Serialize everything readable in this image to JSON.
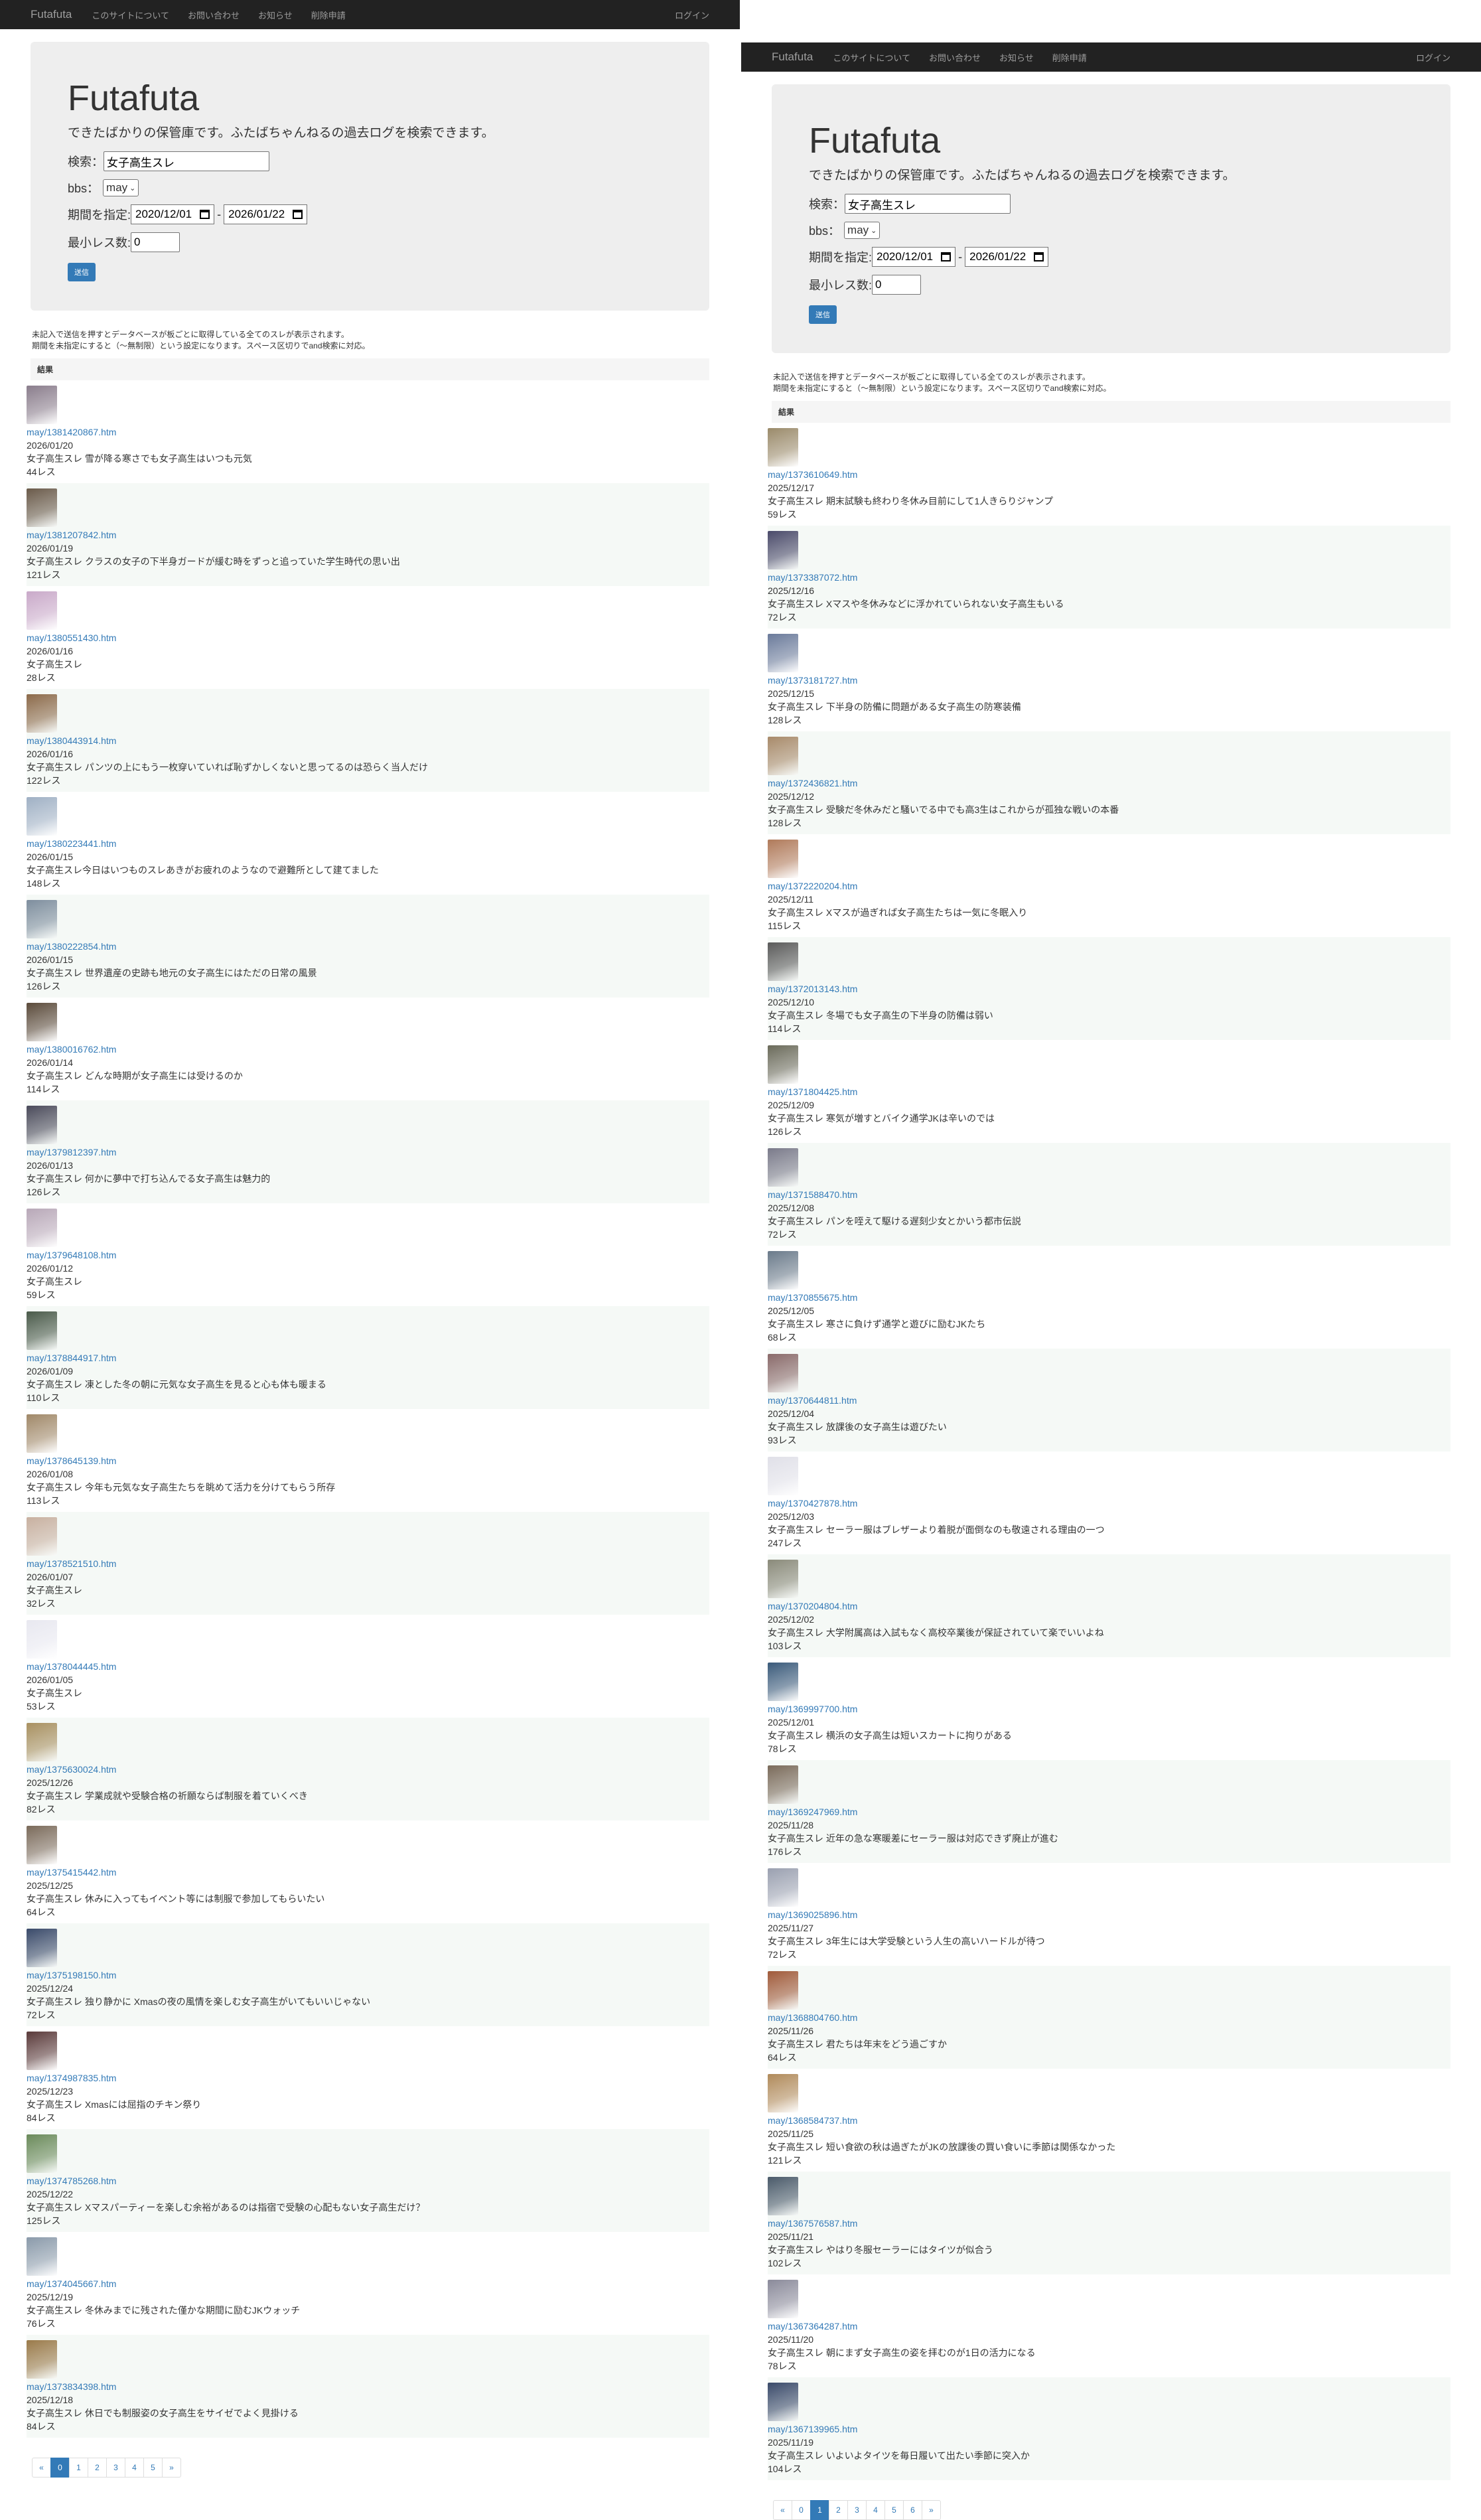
{
  "nav": {
    "brand": "Futafuta",
    "items": [
      "このサイトについて",
      "お問い合わせ",
      "お知らせ",
      "削除申請"
    ],
    "login": "ログイン"
  },
  "hero": {
    "title": "Futafuta",
    "lead": "できたばかりの保管庫です。ふたばちゃんねるの過去ログを検索できます。"
  },
  "form": {
    "search_label": "検索：",
    "search_value": "女子高生スレ",
    "bbs_label": "bbs：",
    "bbs_value": "may",
    "period_label": "期間を指定:",
    "date_from": "2020/12/01",
    "date_sep": "-",
    "date_to": "2026/01/22",
    "min_label": "最小レス数:",
    "min_value": "0",
    "submit": "送信"
  },
  "notes": [
    "未記入で送信を押すとデータベースが板ごとに取得している全てのスレが表示されます。",
    "期間を未指定にすると（～無制限）という設定になります。スペース区切りでand検索に対応。"
  ],
  "results_header": "結果",
  "colors": {
    "accent": "#337ab7",
    "navbar": "#222222",
    "jumbotron": "#eeeeee"
  },
  "left": {
    "items": [
      {
        "link": "may/1381420867.htm",
        "date": "2026/01/20",
        "title": "女子高生スレ 雪が降る寒さでも女子高生はいつも元気",
        "count": "44レス",
        "c": "#8a7d8c"
      },
      {
        "link": "may/1381207842.htm",
        "date": "2026/01/19",
        "title": "女子高生スレ クラスの女子の下半身ガードが緩む時をずっと追っていた学生時代の思い出",
        "count": "121レス",
        "c": "#6a5a4a"
      },
      {
        "link": "may/1380551430.htm",
        "date": "2026/01/16",
        "title": "女子高生スレ",
        "count": "28レス",
        "c": "#c9a9c9"
      },
      {
        "link": "may/1380443914.htm",
        "date": "2026/01/16",
        "title": "女子高生スレ パンツの上にもう一枚穿いていれば恥ずかしくないと思ってるのは恐らく当人だけ",
        "count": "122レス",
        "c": "#8c6a4a"
      },
      {
        "link": "may/1380223441.htm",
        "date": "2026/01/15",
        "title": "女子高生スレ今日はいつものスレあきがお疲れのようなので避難所として建てました",
        "count": "148レス",
        "c": "#9fb0c4"
      },
      {
        "link": "may/1380222854.htm",
        "date": "2026/01/15",
        "title": "女子高生スレ 世界遺産の史跡も地元の女子高生にはただの日常の風景",
        "count": "126レス",
        "c": "#7e8e9e"
      },
      {
        "link": "may/1380016762.htm",
        "date": "2026/01/14",
        "title": "女子高生スレ どんな時期が女子高生には受けるのか",
        "count": "114レス",
        "c": "#5a4a3a"
      },
      {
        "link": "may/1379812397.htm",
        "date": "2026/01/13",
        "title": "女子高生スレ 何かに夢中で打ち込んでる女子高生は魅力的",
        "count": "126レス",
        "c": "#4a4a5a"
      },
      {
        "link": "may/1379648108.htm",
        "date": "2026/01/12",
        "title": "女子高生スレ",
        "count": "59レス",
        "c": "#b8a8b8"
      },
      {
        "link": "may/1378844917.htm",
        "date": "2026/01/09",
        "title": "女子高生スレ 凍とした冬の朝に元気な女子高生を見ると心も体も暖まる",
        "count": "110レス",
        "c": "#4a5a4a"
      },
      {
        "link": "may/1378645139.htm",
        "date": "2026/01/08",
        "title": "女子高生スレ 今年も元気な女子高生たちを眺めて活力を分けてもらう所存",
        "count": "113レス",
        "c": "#a08868"
      },
      {
        "link": "may/1378521510.htm",
        "date": "2026/01/07",
        "title": "女子高生スレ",
        "count": "32レス",
        "c": "#c8b0a0"
      },
      {
        "link": "may/1378044445.htm",
        "date": "2026/01/05",
        "title": "女子高生スレ",
        "count": "53レス",
        "c": "#e8e8f0"
      },
      {
        "link": "may/1375630024.htm",
        "date": "2025/12/26",
        "title": "女子高生スレ 学業成就や受験合格の祈願ならば制服を着ていくべき",
        "count": "82レス",
        "c": "#a89060"
      },
      {
        "link": "may/1375415442.htm",
        "date": "2025/12/25",
        "title": "女子高生スレ 休みに入ってもイベント等には制服で参加してもらいたい",
        "count": "64レス",
        "c": "#7a6a5a"
      },
      {
        "link": "may/1375198150.htm",
        "date": "2025/12/24",
        "title": "女子高生スレ 独り静かに Xmasの夜の風情を楽しむ女子高生がいてもいいじゃない",
        "count": "72レス",
        "c": "#3a4a6a"
      },
      {
        "link": "may/1374987835.htm",
        "date": "2025/12/23",
        "title": "女子高生スレ Xmasには屈指のチキン祭り",
        "count": "84レス",
        "c": "#5a3a3a"
      },
      {
        "link": "may/1374785268.htm",
        "date": "2025/12/22",
        "title": "女子高生スレ Xマスパーティーを楽しむ余裕があるのは指宿で受験の心配もない女子高生だけ？",
        "count": "125レス",
        "c": "#6a8a5a"
      },
      {
        "link": "may/1374045667.htm",
        "date": "2025/12/19",
        "title": "女子高生スレ 冬休みまでに残された僅かな期間に励むJKウォッチ",
        "count": "76レス",
        "c": "#8a9aaa"
      },
      {
        "link": "may/1373834398.htm",
        "date": "2025/12/18",
        "title": "女子高生スレ 休日でも制服姿の女子高生をサイゼでよく見掛ける",
        "count": "84レス",
        "c": "#9a7a4a"
      }
    ],
    "pages": [
      "«",
      "0",
      "1",
      "2",
      "3",
      "4",
      "5",
      "»"
    ],
    "active": "0"
  },
  "right": {
    "items": [
      {
        "link": "may/1373610649.htm",
        "date": "2025/12/17",
        "title": "女子高生スレ 期末試験も終わり冬休み目前にして1人きらりジャンプ",
        "count": "59レス",
        "c": "#9a8a6a"
      },
      {
        "link": "may/1373387072.htm",
        "date": "2025/12/16",
        "title": "女子高生スレ Xマスや冬休みなどに浮かれていられない女子高生もいる",
        "count": "72レス",
        "c": "#4a4a6a"
      },
      {
        "link": "may/1373181727.htm",
        "date": "2025/12/15",
        "title": "女子高生スレ 下半身の防備に問題がある女子高生の防寒装備",
        "count": "128レス",
        "c": "#6a7a9a"
      },
      {
        "link": "may/1372436821.htm",
        "date": "2025/12/12",
        "title": "女子高生スレ 受験だ冬休みだと騒いでる中でも高3生はこれからが孤独な戦いの本番",
        "count": "128レス",
        "c": "#a88a6a"
      },
      {
        "link": "may/1372220204.htm",
        "date": "2025/12/11",
        "title": "女子高生スレ Xマスが過ぎれば女子高生たちは一気に冬眠入り",
        "count": "115レス",
        "c": "#b07a5a"
      },
      {
        "link": "may/1372013143.htm",
        "date": "2025/12/10",
        "title": "女子高生スレ 冬場でも女子高生の下半身の防備は弱い",
        "count": "114レス",
        "c": "#5a5a5a"
      },
      {
        "link": "may/1371804425.htm",
        "date": "2025/12/09",
        "title": "女子高生スレ 寒気が増すとバイク通学JKは辛いのでは",
        "count": "126レス",
        "c": "#6a6a5a"
      },
      {
        "link": "may/1371588470.htm",
        "date": "2025/12/08",
        "title": "女子高生スレ パンを咥えて駆ける遅刻少女とかいう都市伝説",
        "count": "72レス",
        "c": "#7a7a8a"
      },
      {
        "link": "may/1370855675.htm",
        "date": "2025/12/05",
        "title": "女子高生スレ 寒さに負けず通学と遊びに励むJKたち",
        "count": "68レス",
        "c": "#6a7a8a"
      },
      {
        "link": "may/1370644811.htm",
        "date": "2025/12/04",
        "title": "女子高生スレ 放課後の女子高生は遊びたい",
        "count": "93レス",
        "c": "#8a6a6a"
      },
      {
        "link": "may/1370427878.htm",
        "date": "2025/12/03",
        "title": "女子高生スレ セーラー服はブレザーより着脱が面倒なのも敬遠される理由の一つ",
        "count": "247レス",
        "c": "#e0e0e8"
      },
      {
        "link": "may/1370204804.htm",
        "date": "2025/12/02",
        "title": "女子高生スレ 大学附属高は入試もなく高校卒業後が保証されていて楽でいいよね",
        "count": "103レス",
        "c": "#8a8a7a"
      },
      {
        "link": "may/1369997700.htm",
        "date": "2025/12/01",
        "title": "女子高生スレ 横浜の女子高生は短いスカートに拘りがある",
        "count": "78レス",
        "c": "#3a5a7a"
      },
      {
        "link": "may/1369247969.htm",
        "date": "2025/11/28",
        "title": "女子高生スレ 近年の急な寒暖差にセーラー服は対応できず廃止が進む",
        "count": "176レス",
        "c": "#7a6a5a"
      },
      {
        "link": "may/1369025896.htm",
        "date": "2025/11/27",
        "title": "女子高生スレ 3年生には大学受験という人生の高いハードルが待つ",
        "count": "72レス",
        "c": "#9aa0b0"
      },
      {
        "link": "may/1368804760.htm",
        "date": "2025/11/26",
        "title": "女子高生スレ 君たちは年末をどう過ごすか",
        "count": "64レス",
        "c": "#a05a3a"
      },
      {
        "link": "may/1368584737.htm",
        "date": "2025/11/25",
        "title": "女子高生スレ 短い食欲の秋は過ぎたがJKの放課後の買い食いに季節は関係なかった",
        "count": "121レス",
        "c": "#b08a5a"
      },
      {
        "link": "may/1367576587.htm",
        "date": "2025/11/21",
        "title": "女子高生スレ やはり冬服セーラーにはタイツが似合う",
        "count": "102レス",
        "c": "#4a5a6a"
      },
      {
        "link": "may/1367364287.htm",
        "date": "2025/11/20",
        "title": "女子高生スレ 朝にまず女子高生の姿を拝むのが1日の活力になる",
        "count": "78レス",
        "c": "#8a8a9a"
      },
      {
        "link": "may/1367139965.htm",
        "date": "2025/11/19",
        "title": "女子高生スレ いよいよタイツを毎日履いて出たい季節に突入か",
        "count": "104レス",
        "c": "#3a4a6a"
      }
    ],
    "pages": [
      "«",
      "0",
      "1",
      "2",
      "3",
      "4",
      "5",
      "6",
      "»"
    ],
    "active": "1"
  }
}
